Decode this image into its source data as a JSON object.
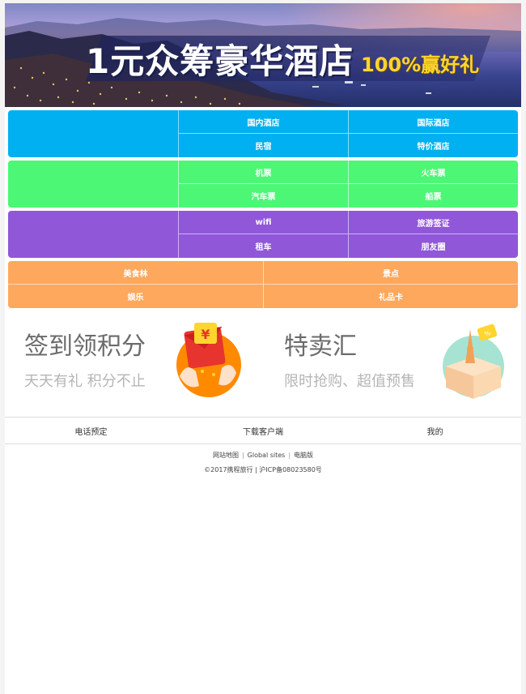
{
  "banner": {
    "title": "1元众筹豪华酒店",
    "subtitle": "100%赢好礼"
  },
  "nav": {
    "hotel": [
      "国内酒店",
      "国际酒店",
      "民宿",
      "特价酒店"
    ],
    "transport": [
      "机票",
      "火车票",
      "汽车票",
      "船票"
    ],
    "travel": [
      "wifi",
      "旅游签证",
      "租车",
      "朋友圈"
    ],
    "leisure": [
      "美食林",
      "景点",
      "娱乐",
      "礼品卡"
    ]
  },
  "promo": {
    "checkin": {
      "title": "签到领积分",
      "subtitle": "天天有礼 积分不止"
    },
    "sale": {
      "title": "特卖汇",
      "subtitle": "限时抢购、超值预售"
    }
  },
  "footer": {
    "items": [
      "电话预定",
      "下载客户端",
      "我的"
    ],
    "links": [
      "网站地图",
      "Global sites",
      "电脑版"
    ],
    "copyright": "©2017携程旅行 | 沪ICP备08023580号"
  },
  "colors": {
    "hotel": "#00b0f0",
    "transport": "#4cf776",
    "travel": "#9057d9",
    "leisure": "#fea85d",
    "subtitle": "#ffd52e"
  }
}
